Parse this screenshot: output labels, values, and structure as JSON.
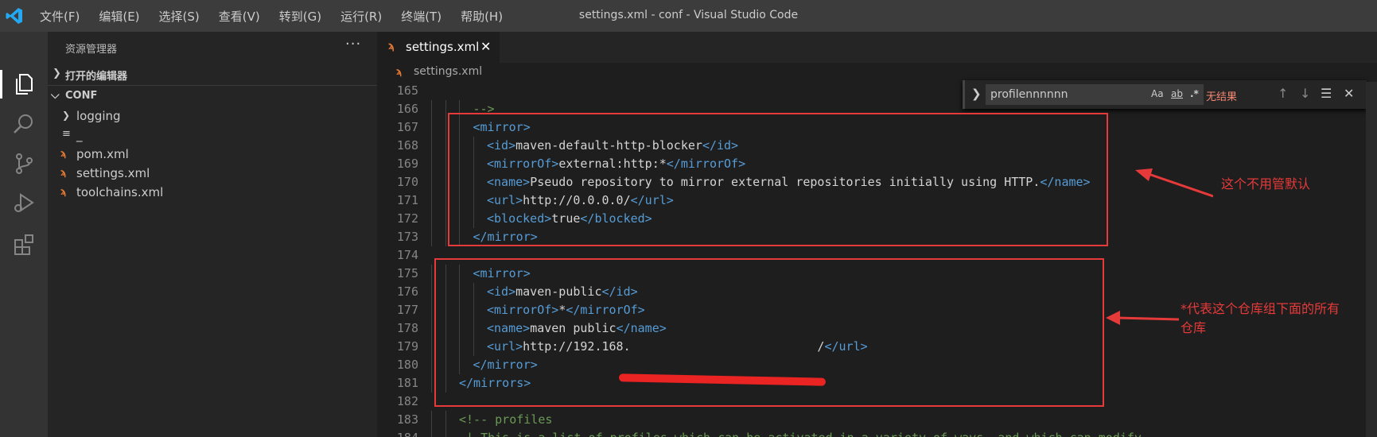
{
  "window": {
    "title": "settings.xml - conf - Visual Studio Code",
    "menu": [
      "文件(F)",
      "编辑(E)",
      "选择(S)",
      "查看(V)",
      "转到(G)",
      "运行(R)",
      "终端(T)",
      "帮助(H)"
    ]
  },
  "sidebar": {
    "title": "资源管理器",
    "more": "···",
    "open_editors": "打开的编辑器",
    "folder": "CONF",
    "items": [
      {
        "label": "logging",
        "icon": "chevron-right-icon"
      },
      {
        "label": "_",
        "icon": "lines-file-icon"
      },
      {
        "label": "pom.xml",
        "icon": "rss-xml-icon"
      },
      {
        "label": "settings.xml",
        "icon": "rss-xml-icon"
      },
      {
        "label": "toolchains.xml",
        "icon": "rss-xml-icon"
      }
    ]
  },
  "editor": {
    "tab": {
      "label": "settings.xml"
    },
    "breadcrumb": "settings.xml",
    "find": {
      "query": "profilennnnnn",
      "match_case": "Aa",
      "whole_word": "ab",
      "regex": ".*",
      "result": "无结果"
    },
    "lines": [
      {
        "n": "165",
        "indent": 0,
        "parts": []
      },
      {
        "n": "166",
        "indent": 3,
        "parts": [
          {
            "c": "cm",
            "t": "-->"
          }
        ]
      },
      {
        "n": "167",
        "indent": 3,
        "parts": [
          {
            "c": "tg",
            "t": "<mirror>"
          }
        ]
      },
      {
        "n": "168",
        "indent": 4,
        "parts": [
          {
            "c": "tg",
            "t": "<id>"
          },
          {
            "c": "tx",
            "t": "maven-default-http-blocker"
          },
          {
            "c": "tg",
            "t": "</id>"
          }
        ]
      },
      {
        "n": "169",
        "indent": 4,
        "parts": [
          {
            "c": "tg",
            "t": "<mirrorOf>"
          },
          {
            "c": "tx",
            "t": "external:http:*"
          },
          {
            "c": "tg",
            "t": "</mirrorOf>"
          }
        ]
      },
      {
        "n": "170",
        "indent": 4,
        "parts": [
          {
            "c": "tg",
            "t": "<name>"
          },
          {
            "c": "tx",
            "t": "Pseudo repository to mirror external repositories initially using HTTP."
          },
          {
            "c": "tg",
            "t": "</name>"
          }
        ]
      },
      {
        "n": "171",
        "indent": 4,
        "parts": [
          {
            "c": "tg",
            "t": "<url>"
          },
          {
            "c": "tx",
            "t": "http://0.0.0.0/"
          },
          {
            "c": "tg",
            "t": "</url>"
          }
        ]
      },
      {
        "n": "172",
        "indent": 4,
        "parts": [
          {
            "c": "tg",
            "t": "<blocked>"
          },
          {
            "c": "tx",
            "t": "true"
          },
          {
            "c": "tg",
            "t": "</blocked>"
          }
        ]
      },
      {
        "n": "173",
        "indent": 3,
        "parts": [
          {
            "c": "tg",
            "t": "</mirror>"
          }
        ]
      },
      {
        "n": "174",
        "indent": 0,
        "parts": []
      },
      {
        "n": "175",
        "indent": 3,
        "parts": [
          {
            "c": "tg",
            "t": "<mirror>"
          }
        ]
      },
      {
        "n": "176",
        "indent": 4,
        "parts": [
          {
            "c": "tg",
            "t": "<id>"
          },
          {
            "c": "tx",
            "t": "maven-public"
          },
          {
            "c": "tg",
            "t": "</id>"
          }
        ]
      },
      {
        "n": "177",
        "indent": 4,
        "parts": [
          {
            "c": "tg",
            "t": "<mirrorOf>"
          },
          {
            "c": "tx",
            "t": "*"
          },
          {
            "c": "tg",
            "t": "</mirrorOf>"
          }
        ]
      },
      {
        "n": "178",
        "indent": 4,
        "parts": [
          {
            "c": "tg",
            "t": "<name>"
          },
          {
            "c": "tx",
            "t": "maven public"
          },
          {
            "c": "tg",
            "t": "</name>"
          }
        ]
      },
      {
        "n": "179",
        "indent": 4,
        "parts": [
          {
            "c": "tg",
            "t": "<url>"
          },
          {
            "c": "tx",
            "t": "http://192.168.                          /"
          },
          {
            "c": "tg",
            "t": "</url>"
          }
        ]
      },
      {
        "n": "180",
        "indent": 3,
        "parts": [
          {
            "c": "tg",
            "t": "</mirror>"
          }
        ]
      },
      {
        "n": "181",
        "indent": 2,
        "parts": [
          {
            "c": "tg",
            "t": "</mirrors>"
          }
        ]
      },
      {
        "n": "182",
        "indent": 0,
        "parts": []
      },
      {
        "n": "183",
        "indent": 2,
        "parts": [
          {
            "c": "cm",
            "t": "<!-- profiles"
          }
        ]
      },
      {
        "n": "184",
        "indent": 2,
        "parts": [
          {
            "c": "cm",
            "t": " | This is a list of profiles which can be activated in a variety of ways, and which can modify"
          }
        ]
      }
    ]
  },
  "annotations": {
    "note1": "这个不用管默认",
    "note2_line1": "*代表这个仓库组下面的所有",
    "note2_line2": "仓库",
    "color": "#e63a3a"
  }
}
